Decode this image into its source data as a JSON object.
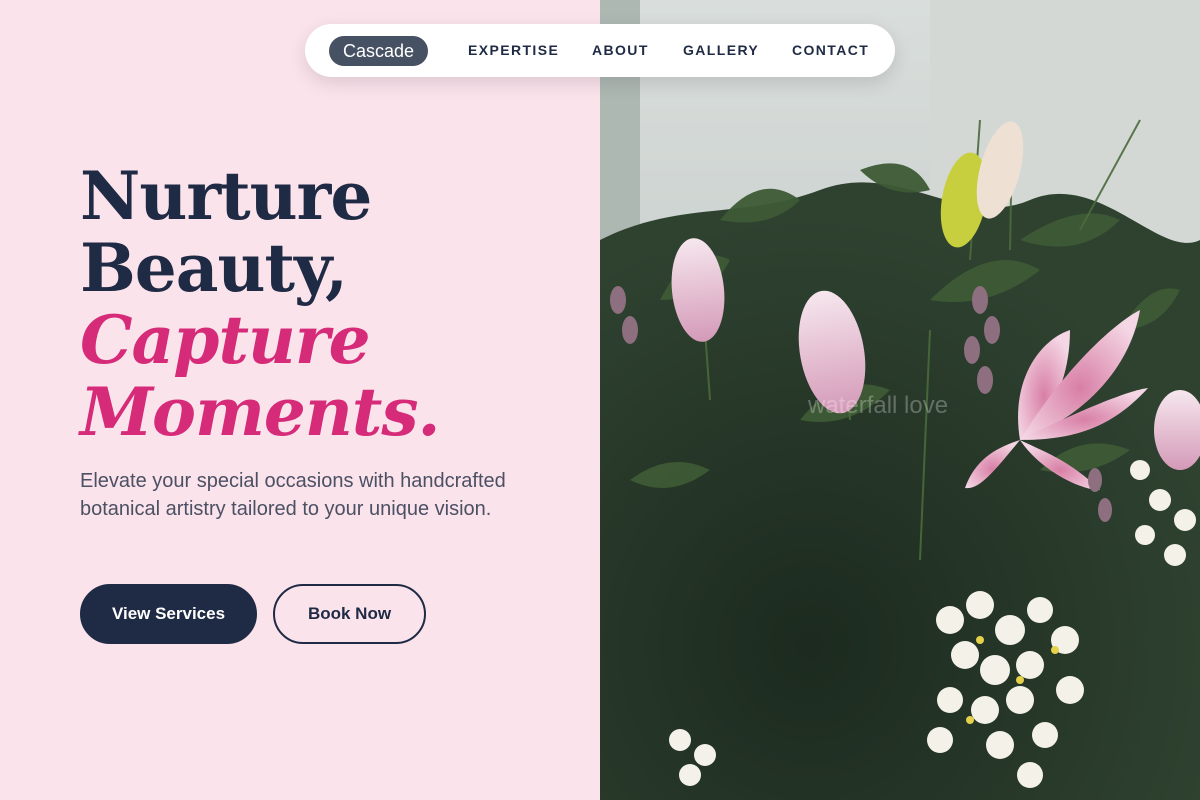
{
  "nav": {
    "logo": "Cascade",
    "links": [
      "EXPERTISE",
      "ABOUT",
      "GALLERY",
      "CONTACT"
    ]
  },
  "hero": {
    "headline_line1": "Nurture",
    "headline_line2": "Beauty,",
    "headline_accent_line1": "Capture",
    "headline_accent_line2": "Moments.",
    "description": "Elevate your special occasions with handcrafted botanical artistry tailored to your unique vision.",
    "primary_button": "View Services",
    "secondary_button": "Book Now"
  },
  "image": {
    "watermark": "waterfall love",
    "subject": "flower-arrangement-photo"
  },
  "colors": {
    "background": "#fbe3ec",
    "text_dark": "#1f2a44",
    "accent_pink": "#d62b78",
    "logo_bg": "#475164",
    "white": "#ffffff"
  }
}
